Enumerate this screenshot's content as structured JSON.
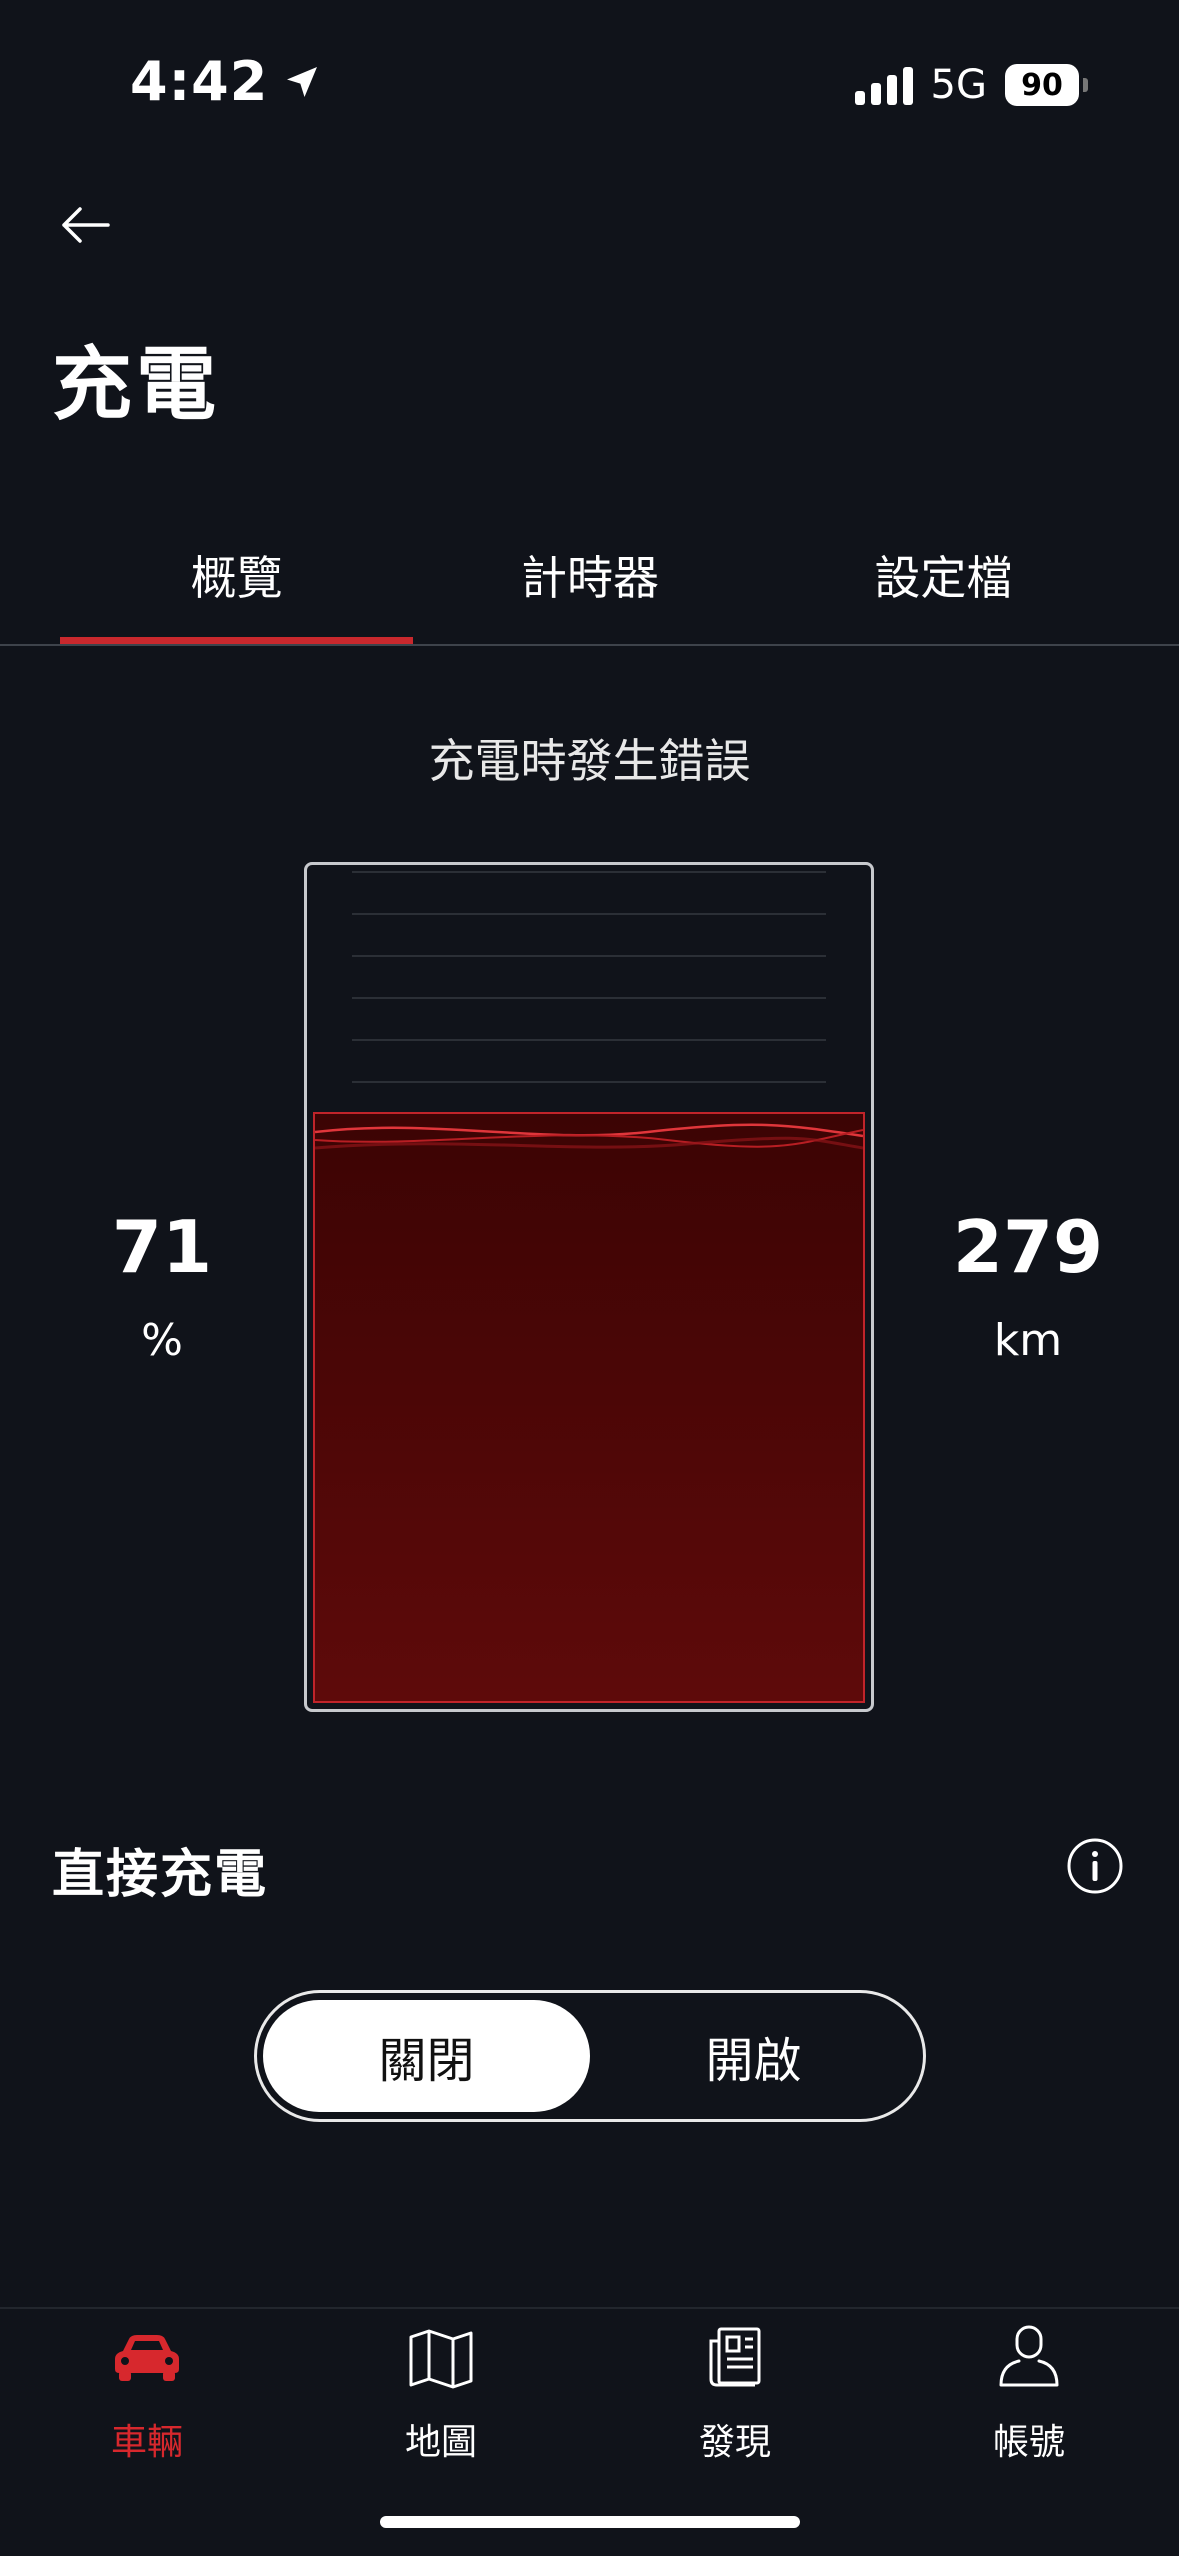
{
  "status_bar": {
    "time": "4:42",
    "network": "5G",
    "battery": "90"
  },
  "header": {
    "title": "充電"
  },
  "tabs": [
    {
      "label": "概覽",
      "active": true
    },
    {
      "label": "計時器",
      "active": false
    },
    {
      "label": "設定檔",
      "active": false
    }
  ],
  "overview": {
    "status_message": "充電時發生錯誤",
    "state_of_charge": {
      "value": "71",
      "unit": "%"
    },
    "range": {
      "value": "279",
      "unit": "km"
    },
    "battery_fill_level": 0.71
  },
  "direct_charging": {
    "title": "直接充電",
    "toggle": {
      "off_label": "關閉",
      "on_label": "開啟",
      "selected": "off"
    }
  },
  "bottom_nav": {
    "items": [
      {
        "label": "車輛",
        "icon": "car-icon",
        "active": true
      },
      {
        "label": "地圖",
        "icon": "map-icon",
        "active": false
      },
      {
        "label": "發現",
        "icon": "news-icon",
        "active": false
      },
      {
        "label": "帳號",
        "icon": "user-icon",
        "active": false
      }
    ]
  },
  "colors": {
    "background": "#10131a",
    "accent": "#c9282d",
    "battery_fill": "#5e0a0a"
  }
}
